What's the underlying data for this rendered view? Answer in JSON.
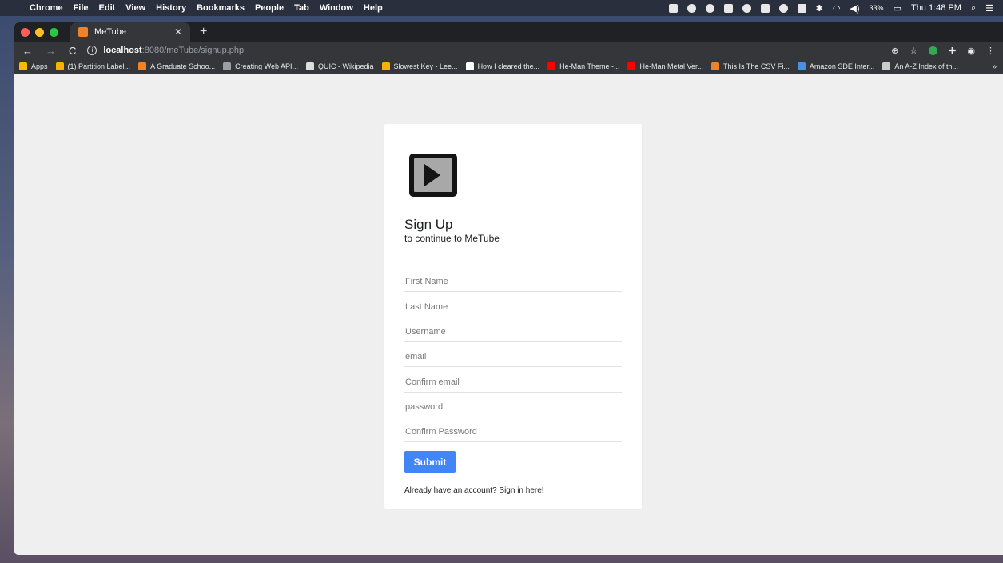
{
  "menubar": {
    "app": "Chrome",
    "menus": [
      "File",
      "Edit",
      "View",
      "History",
      "Bookmarks",
      "People",
      "Tab",
      "Window",
      "Help"
    ],
    "battery": "33%",
    "clock": "Thu 1:48 PM"
  },
  "browser": {
    "tab_title": "MeTube",
    "url_host": "localhost",
    "url_path": ":8080/meTube/signup.php",
    "bookmarks": [
      {
        "label": "Apps",
        "color": "#fbbc04"
      },
      {
        "label": "(1) Partition Label...",
        "color": "#f4b400"
      },
      {
        "label": "A Graduate Schoo...",
        "color": "#f0822a"
      },
      {
        "label": "Creating Web API...",
        "color": "#9aa0a6"
      },
      {
        "label": "QUIC - Wikipedia",
        "color": "#dddddd"
      },
      {
        "label": "Slowest Key - Lee...",
        "color": "#f4b400"
      },
      {
        "label": "How I cleared the...",
        "color": "#ffffff"
      },
      {
        "label": "He-Man Theme -...",
        "color": "#ff0000"
      },
      {
        "label": "He-Man Metal Ver...",
        "color": "#ff0000"
      },
      {
        "label": "This Is The CSV Fi...",
        "color": "#f0822a"
      },
      {
        "label": "Amazon SDE Inter...",
        "color": "#4a90e2"
      },
      {
        "label": "An A-Z Index of th...",
        "color": "#cccccc"
      }
    ],
    "more": "»"
  },
  "form": {
    "title": "Sign Up",
    "subtitle": "to continue to MeTube",
    "fields": {
      "first_name": "First Name",
      "last_name": "Last Name",
      "username": "Username",
      "email": "email",
      "confirm_email": "Confirm email",
      "password": "password",
      "confirm_password": "Confirm Password"
    },
    "submit_label": "Submit",
    "signin_text": "Already have an account? Sign in here!"
  }
}
